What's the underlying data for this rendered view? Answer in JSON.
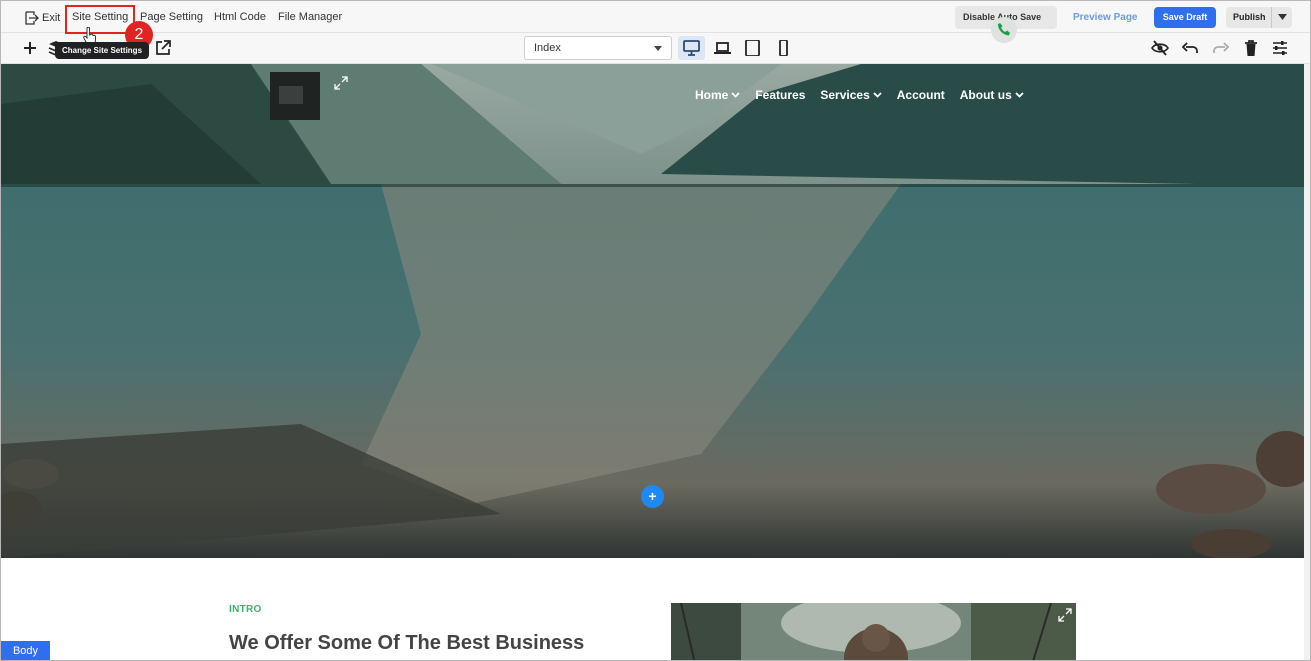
{
  "topbar": {
    "exit_label": "Exit",
    "site_setting_label": "Site Setting",
    "page_setting_label": "Page Setting",
    "html_code_label": "Html Code",
    "file_manager_label": "File Manager",
    "step_number": "2",
    "tooltip": "Change Site Settings",
    "disable_autosave_label": "Disable Auto Save",
    "preview_label": "Preview Page",
    "save_draft_label": "Save Draft",
    "publish_label": "Publish"
  },
  "toolbar": {
    "page_select_value": "Index",
    "devices": [
      "desktop",
      "laptop",
      "tablet",
      "mobile"
    ],
    "active_device": "desktop",
    "icons": [
      "plus-icon",
      "layers-icon",
      "external-link-icon",
      "eye-off-icon",
      "undo-icon",
      "redo-icon",
      "trash-icon",
      "sliders-icon"
    ]
  },
  "hero": {
    "nav": [
      {
        "label": "Home",
        "has_dropdown": true
      },
      {
        "label": "Features",
        "has_dropdown": false
      },
      {
        "label": "Services",
        "has_dropdown": true
      },
      {
        "label": "Account",
        "has_dropdown": false
      },
      {
        "label": "About us",
        "has_dropdown": true
      }
    ],
    "add_section_label": "+"
  },
  "intro": {
    "label": "INTRO",
    "heading": "We Offer Some Of The Best Business"
  },
  "body_tag": "Body",
  "colors": {
    "accent": "#2f6fed",
    "highlight": "#e02424",
    "intro_green": "#39b36b",
    "add_button": "#1e88f5"
  }
}
